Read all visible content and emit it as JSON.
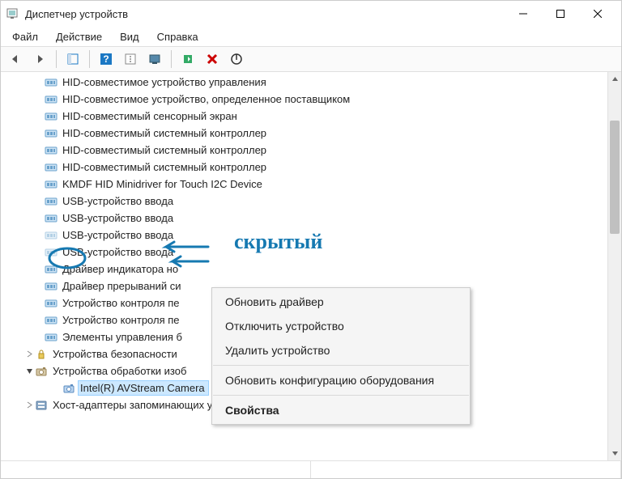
{
  "title": "Диспетчер устройств",
  "menu": {
    "file": "Файл",
    "action": "Действие",
    "view": "Вид",
    "help": "Справка"
  },
  "devices": [
    {
      "label": "HID-совместимое устройство управления",
      "indent": 1
    },
    {
      "label": "HID-совместимое устройство, определенное поставщиком",
      "indent": 1
    },
    {
      "label": "HID-совместимый сенсорный экран",
      "indent": 1
    },
    {
      "label": "HID-совместимый системный контроллер",
      "indent": 1
    },
    {
      "label": "HID-совместимый системный контроллер",
      "indent": 1
    },
    {
      "label": "HID-совместимый системный контроллер",
      "indent": 1
    },
    {
      "label": "KMDF HID Minidriver for Touch I2C Device",
      "indent": 1
    },
    {
      "label": "USB-устройство ввода",
      "indent": 1
    },
    {
      "label": "USB-устройство ввода",
      "indent": 1
    },
    {
      "label": "USB-устройство ввода",
      "indent": 1,
      "dimmed": true
    },
    {
      "label": "USB-устройство ввода",
      "indent": 1,
      "dimmed": true,
      "circled": true
    },
    {
      "label": "Драйвер индикатора но",
      "indent": 1
    },
    {
      "label": "Драйвер прерываний си",
      "indent": 1
    },
    {
      "label": "Устройство контроля пе",
      "indent": 1
    },
    {
      "label": "Устройство контроля пе",
      "indent": 1
    },
    {
      "label": "Элементы управления б",
      "indent": 1
    }
  ],
  "catSecurity": "Устройства безопасности",
  "catImaging": "Устройства обработки изоб",
  "selectedDevice": "Intel(R) AVStream Camera",
  "catStorage": "Хост-адаптеры запоминающих устройств",
  "ctx": {
    "update": "Обновить драйвер",
    "disable": "Отключить устройство",
    "uninstall": "Удалить устройство",
    "scan": "Обновить конфигурацию оборудования",
    "props": "Свойства"
  },
  "annotation": "скрытый"
}
